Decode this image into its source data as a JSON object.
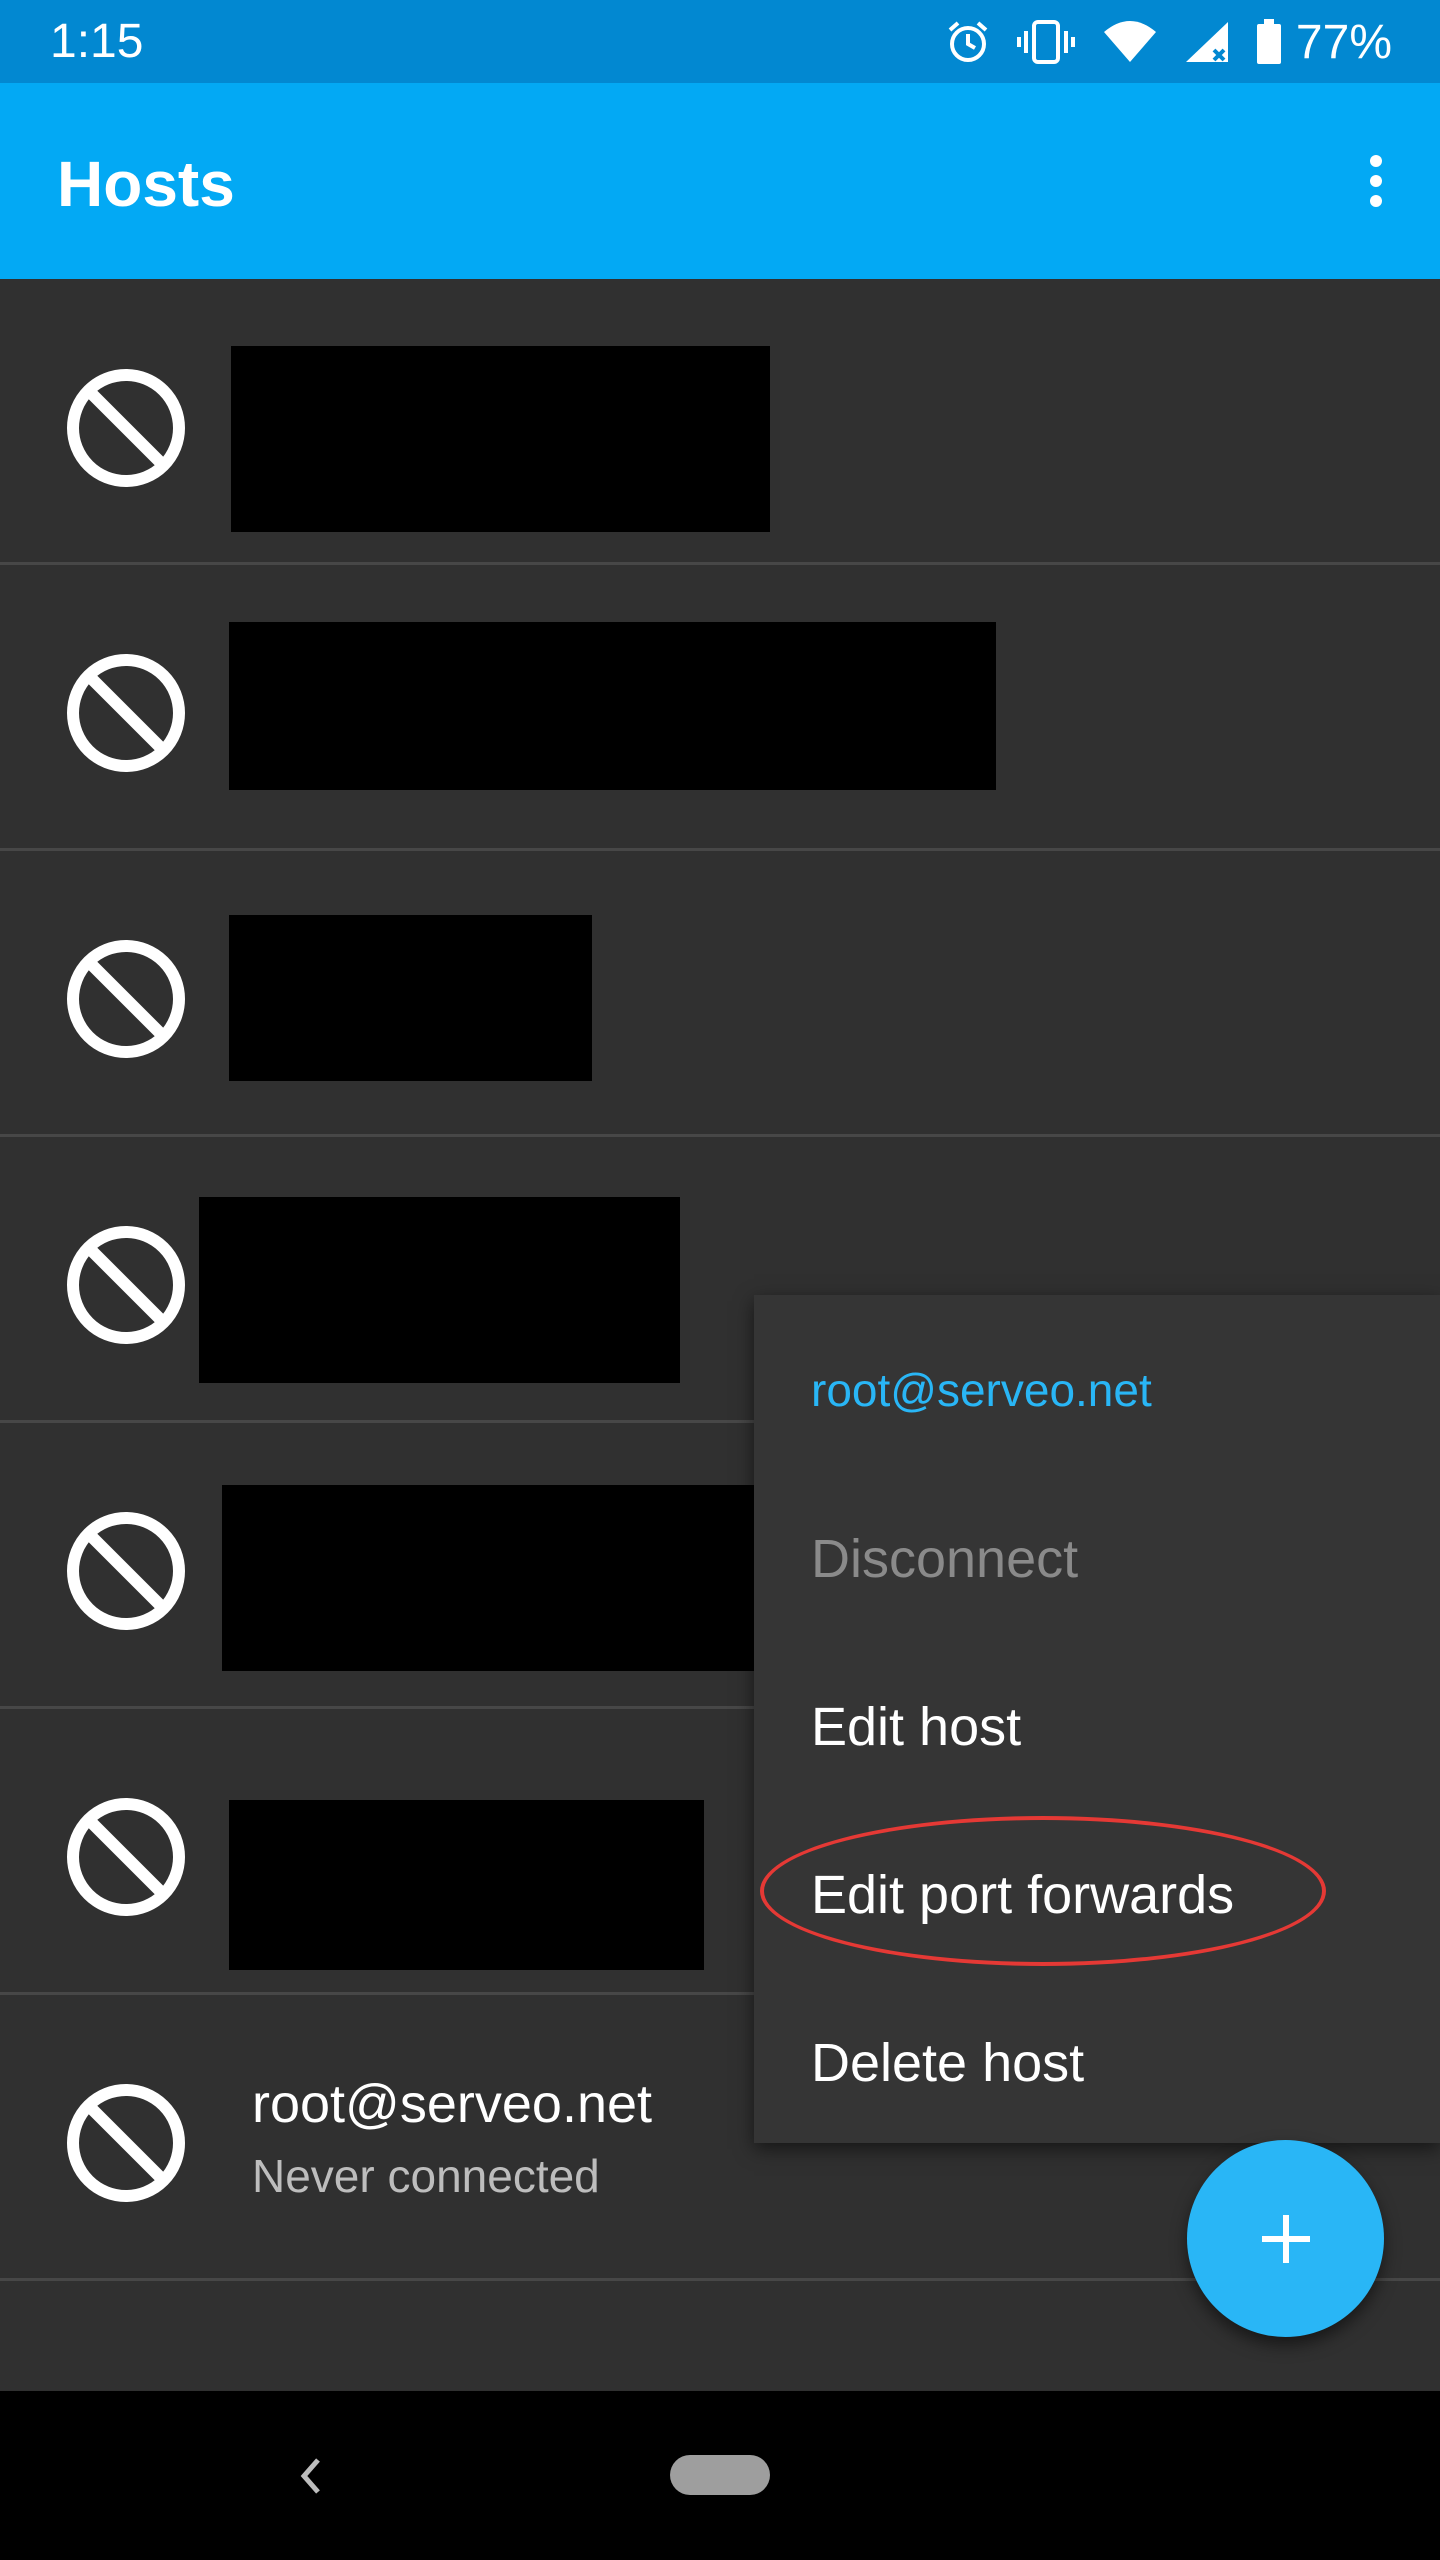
{
  "status_bar": {
    "time": "1:15",
    "battery_percent": "77%",
    "icons": [
      "alarm-icon",
      "vibrate-icon",
      "wifi-icon",
      "cell-signal-icon",
      "battery-icon"
    ]
  },
  "app_bar": {
    "title": "Hosts",
    "overflow_icon": "more-vert-icon"
  },
  "hosts": [
    {
      "status_icon": "blocked-icon",
      "name": "",
      "redacted": true
    },
    {
      "status_icon": "blocked-icon",
      "name": "",
      "redacted": true
    },
    {
      "status_icon": "blocked-icon",
      "name": "",
      "redacted": true
    },
    {
      "status_icon": "blocked-icon",
      "name": "",
      "redacted": true
    },
    {
      "status_icon": "blocked-icon",
      "name": "",
      "redacted": true
    },
    {
      "status_icon": "blocked-icon",
      "name": "",
      "redacted": true
    },
    {
      "status_icon": "blocked-icon",
      "name": "root@serveo.net",
      "subtitle": "Never connected",
      "redacted": false
    }
  ],
  "context_menu": {
    "header": "root@serveo.net",
    "items": [
      {
        "label": "Disconnect",
        "enabled": false
      },
      {
        "label": "Edit host",
        "enabled": true
      },
      {
        "label": "Edit port forwards",
        "enabled": true,
        "highlighted": true
      },
      {
        "label": "Delete host",
        "enabled": true
      }
    ]
  },
  "fab": {
    "icon": "plus-icon"
  },
  "nav_bar": {
    "back_icon": "back-chevron-icon",
    "home_icon": "home-pill-icon"
  },
  "colors": {
    "status_bar": "#0288d1",
    "app_bar": "#03a9f4",
    "background": "#303030",
    "accent": "#29b6f6",
    "highlight_ring": "#e53935"
  }
}
